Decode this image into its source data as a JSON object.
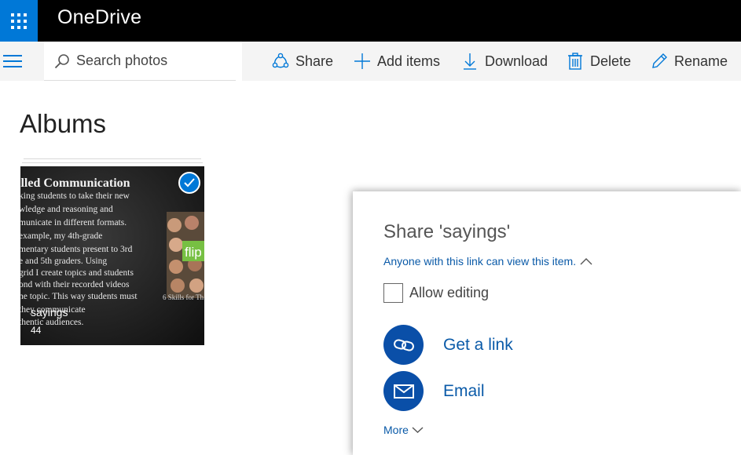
{
  "topbar": {
    "app_title": "OneDrive",
    "waffle_icon": "app-launcher-icon"
  },
  "cmdbar": {
    "search_placeholder": "Search photos",
    "commands": {
      "share": "Share",
      "add_items": "Add items",
      "download": "Download",
      "delete": "Delete",
      "rename": "Rename"
    }
  },
  "main": {
    "title": "Albums",
    "albums": [
      {
        "name": "sayings",
        "count": "44",
        "selected": true
      }
    ]
  },
  "thumb_text": {
    "heading": "illed Communication",
    "lines": [
      "king students to take their new",
      "wledge and reasoning and",
      "municate in different formats.",
      "example, my 4th-grade",
      "mentary students present to 3rd",
      "e and 5th graders. Using",
      "grid I create topics and students",
      "ond with their recorded videos",
      "he topic. This way students must",
      "   they communicate",
      "thentic audiences."
    ],
    "badge": "flip",
    "caption": "6 Skills for Th"
  },
  "share_panel": {
    "title": "Share 'sayings'",
    "permission_text": "Anyone with this link can view this item.",
    "allow_editing": "Allow editing",
    "get_link": "Get a link",
    "email": "Email",
    "more": "More"
  },
  "colors": {
    "accent": "#0078d7",
    "link": "#0a5aa8",
    "topbar": "#000000",
    "cmdbar": "#f4f4f4"
  }
}
